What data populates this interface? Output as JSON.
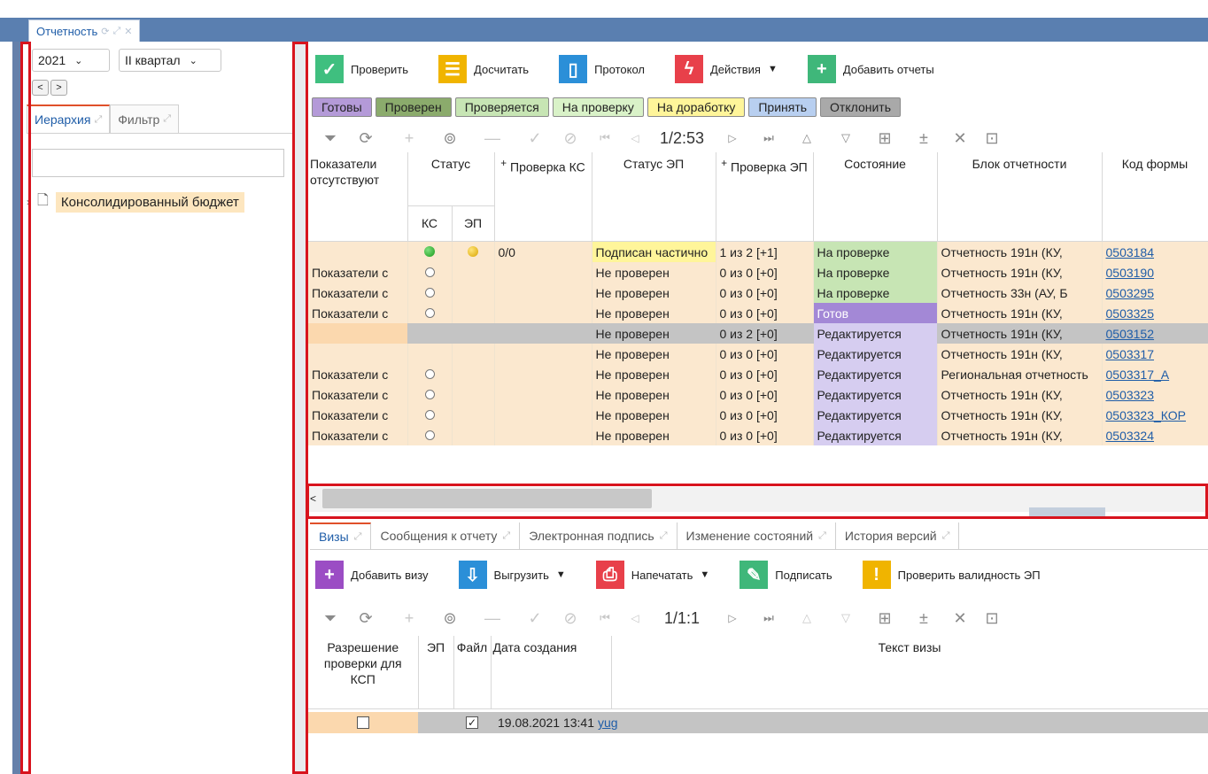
{
  "main_tab": {
    "label": "Отчетность"
  },
  "left": {
    "year": "2021",
    "quarter": "II квартал",
    "prev_btn": "<",
    "next_btn": ">",
    "tabs": [
      {
        "label": "Иерархия"
      },
      {
        "label": "Фильтр"
      }
    ],
    "tree": [
      {
        "label": "Консолидированный бюджет"
      }
    ]
  },
  "toolbar": {
    "check": "Проверить",
    "recalc": "Досчитать",
    "protocol": "Протокол",
    "actions": "Действия",
    "add_reports": "Добавить отчеты"
  },
  "status_buttons": [
    {
      "label": "Готовы",
      "color": "#b49ad8"
    },
    {
      "label": "Проверен",
      "color": "#8bab6c"
    },
    {
      "label": "Проверяется",
      "color": "#c7e5b4"
    },
    {
      "label": "На проверку",
      "color": "#d9f2c8"
    },
    {
      "label": "На доработку",
      "color": "#fff59a"
    },
    {
      "label": "Принять",
      "color": "#b8cff0"
    },
    {
      "label": "Отклонить",
      "color": "#a9a9a9"
    }
  ],
  "pager_top": {
    "position": "1/2:53"
  },
  "pager_bottom": {
    "position": "1/1:1"
  },
  "grid_headers": {
    "missing": "Показатели отсутствуют",
    "status": "Статус",
    "ks": "КС",
    "ep": "ЭП",
    "check_ks": "Проверка КС",
    "status_ep": "Статус ЭП",
    "check_ep": "Проверка ЭП",
    "state": "Состояние",
    "block": "Блок отчетности",
    "form_code": "Код формы",
    "plus": "+"
  },
  "grid_rows": [
    {
      "missing": "",
      "ks": "green",
      "ep": "yellow",
      "check_ks": "0/0",
      "status_ep": "Подписан частично",
      "check_ep": "1 из 2 [+1]",
      "state": "На проверке",
      "state_kind": "check",
      "block": "Отчетность 191н (КУ,",
      "code": "0503184",
      "sign": true
    },
    {
      "missing": "Показатели с",
      "ks": "empty",
      "ep": "",
      "check_ks": "",
      "status_ep": "Не проверен",
      "check_ep": "0 из 0 [+0]",
      "state": "На проверке",
      "state_kind": "check",
      "block": "Отчетность 191н (КУ,",
      "code": "0503190"
    },
    {
      "missing": "Показатели с",
      "ks": "empty",
      "ep": "",
      "check_ks": "",
      "status_ep": "Не проверен",
      "check_ep": "0 из 0 [+0]",
      "state": "На проверке",
      "state_kind": "check",
      "block": "Отчетность 33н (АУ, Б",
      "code": "0503295"
    },
    {
      "missing": "Показатели с",
      "ks": "empty",
      "ep": "",
      "check_ks": "",
      "status_ep": "Не проверен",
      "check_ep": "0 из 0 [+0]",
      "state": "Готов",
      "state_kind": "ready",
      "block": "Отчетность 191н (КУ,",
      "code": "0503325"
    },
    {
      "missing": "",
      "ks": "",
      "ep": "",
      "check_ks": "",
      "status_ep": "Не проверен",
      "check_ep": "0 из 2 [+0]",
      "state": "Редактируется",
      "state_kind": "edit",
      "block": "Отчетность 191н (КУ,",
      "code": "0503152",
      "selected": true
    },
    {
      "missing": "",
      "ks": "",
      "ep": "",
      "check_ks": "",
      "status_ep": "Не проверен",
      "check_ep": "0 из 0 [+0]",
      "state": "Редактируется",
      "state_kind": "edit",
      "block": "Отчетность 191н (КУ,",
      "code": "0503317"
    },
    {
      "missing": "Показатели с",
      "ks": "empty",
      "ep": "",
      "check_ks": "",
      "status_ep": "Не проверен",
      "check_ep": "0 из 0 [+0]",
      "state": "Редактируется",
      "state_kind": "edit",
      "block": "Региональная отчетность",
      "code": "0503317_A"
    },
    {
      "missing": "Показатели с",
      "ks": "empty",
      "ep": "",
      "check_ks": "",
      "status_ep": "Не проверен",
      "check_ep": "0 из 0 [+0]",
      "state": "Редактируется",
      "state_kind": "edit",
      "block": "Отчетность 191н (КУ,",
      "code": "0503323"
    },
    {
      "missing": "Показатели с",
      "ks": "empty",
      "ep": "",
      "check_ks": "",
      "status_ep": "Не проверен",
      "check_ep": "0 из 0 [+0]",
      "state": "Редактируется",
      "state_kind": "edit",
      "block": "Отчетность 191н (КУ,",
      "code": "0503323_КОР"
    },
    {
      "missing": "Показатели с",
      "ks": "empty",
      "ep": "",
      "check_ks": "",
      "status_ep": "Не проверен",
      "check_ep": "0 из 0 [+0]",
      "state": "Редактируется",
      "state_kind": "edit",
      "block": "Отчетность 191н (КУ,",
      "code": "0503324"
    }
  ],
  "bottom_tabs": [
    {
      "label": "Визы"
    },
    {
      "label": "Сообщения к отчету"
    },
    {
      "label": "Электронная подпись"
    },
    {
      "label": "Изменение состояний"
    },
    {
      "label": "История версий"
    }
  ],
  "bottom_toolbar": {
    "add_visa": "Добавить визу",
    "export": "Выгрузить",
    "print": "Напечатать",
    "sign": "Подписать",
    "validate": "Проверить валидность ЭП"
  },
  "visa_headers": {
    "permission": "Разрешение проверки для КСП",
    "ep": "ЭП",
    "file": "Файл",
    "created": "Дата создания",
    "text": "Текст визы"
  },
  "visa_rows": [
    {
      "permission": false,
      "file": true,
      "created": "19.08.2021 13:41",
      "text": "yug"
    }
  ]
}
